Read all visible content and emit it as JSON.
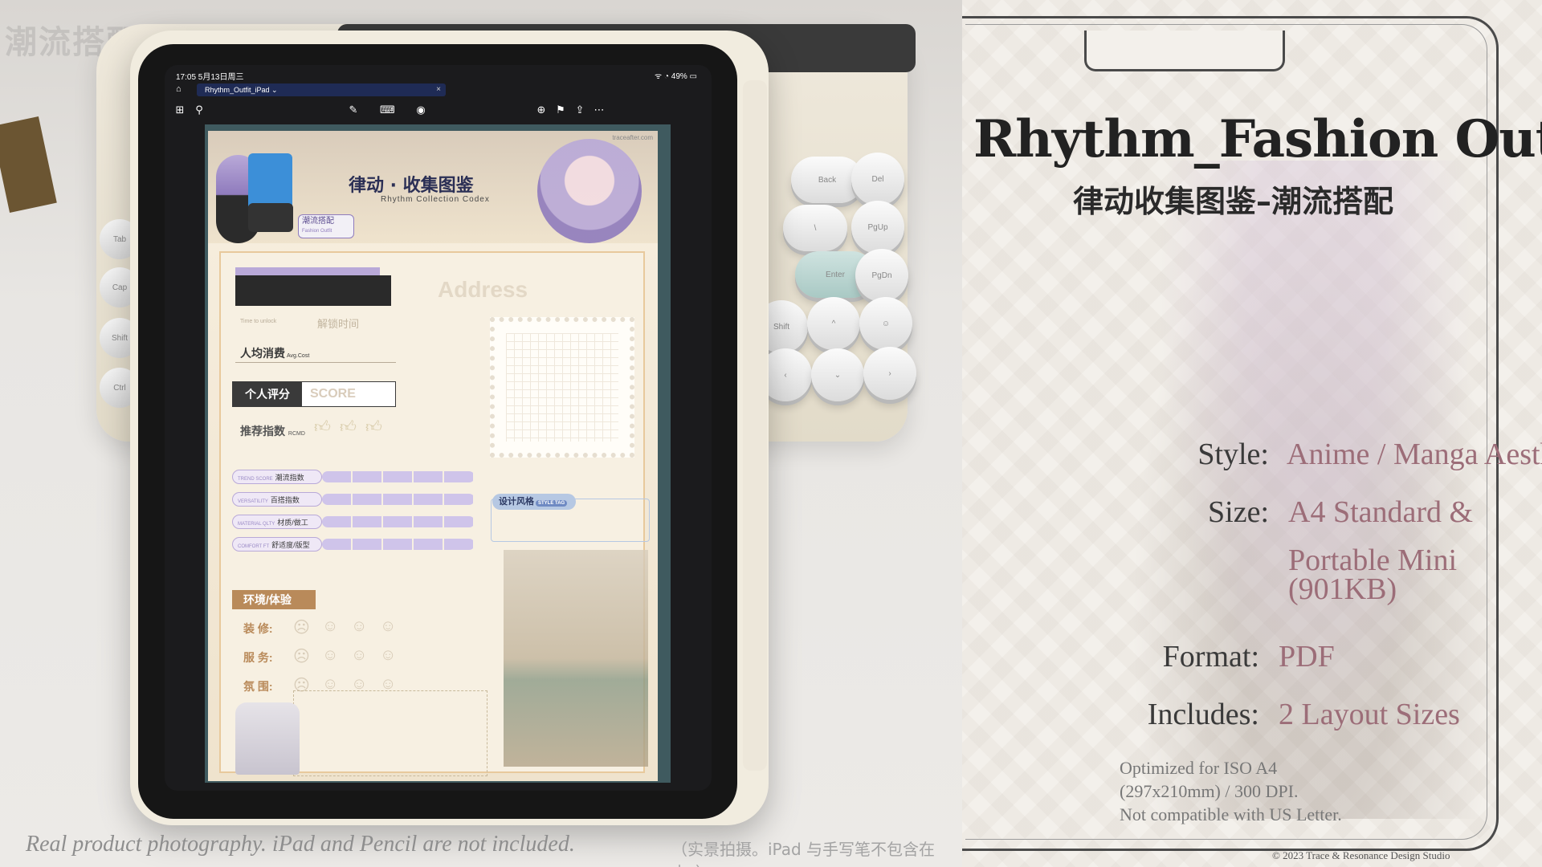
{
  "photo": {
    "watermark": "潮流搭配",
    "status_bar": {
      "time": "17:05  5月13日周三",
      "right": "ᯤ ◔ 49% ▭"
    },
    "tab": {
      "title": "Rhythm_Outfit_iPad  ⌄",
      "close": "×"
    },
    "toolbar_icons": [
      "grid-icon",
      "search-icon",
      "pencil-icon",
      "keyboard-icon",
      "microphone-icon",
      "add-page-icon",
      "bookmark-icon",
      "share-icon",
      "more-icon"
    ],
    "document": {
      "url": "traceafter.com",
      "title_cn": "律动 · 收集图鉴",
      "title_en": "Rhythm Collection Codex",
      "tag_cn": "潮流搭配",
      "tag_en": "Fashion Outfit",
      "address_placeholder": "Address",
      "unlock_en": "Time to unlock",
      "unlock_cn": "解锁时间",
      "avg_cn": "人均消费",
      "avg_en": "Avg.Cost",
      "score_label": "个人评分",
      "score_placeholder": "SCORE",
      "rcmd_cn": "推荐指数",
      "rcmd_en": "RCMD",
      "metrics": [
        {
          "en": "TREND SCORE",
          "cn": "潮流指数"
        },
        {
          "en": "VERSATILITY",
          "cn": "百搭指数"
        },
        {
          "en": "MATERIAL QLTY",
          "cn": "材质/做工"
        },
        {
          "en": "COMFORT FT",
          "cn": "舒适度/版型"
        }
      ],
      "env_tag": "环境/体验",
      "env_rows": [
        "装 修:",
        "服 务:",
        "氛 围:"
      ],
      "style_tag_cn": "设计风格",
      "style_tag_en": "STYLE TAG"
    },
    "keys": {
      "back": "Back",
      "del": "Del",
      "pgup": "PgUp",
      "enter": "Enter",
      "pgdn": "PgDn",
      "shift": "Shift",
      "up": "^",
      "down": "⌄",
      "left": "‹",
      "right": "›",
      "smile": "☺",
      "backslash": "\\"
    },
    "side_keys": [
      "Tab",
      "Cap",
      "Shift",
      "Ctrl"
    ],
    "caption": "Real product photography. iPad and Pencil are not included.",
    "caption_cn": "（实景拍摄。iPad 与手写笔不包含在内。）"
  },
  "panel": {
    "title": "Rhythm_Fashion Outfit",
    "subtitle": "律动收集图鉴–潮流搭配",
    "specs": [
      {
        "key": "Style:",
        "value": "Anime / Manga Aesthetic"
      },
      {
        "key": "Size:",
        "value": "A4 Standard &"
      },
      {
        "key": "",
        "value": "Portable Mini"
      },
      {
        "key": "",
        "value": "(901KB)"
      },
      {
        "key": "Format:",
        "value": "PDF"
      },
      {
        "key": "Includes:",
        "value": "2 Layout Sizes"
      }
    ],
    "note_lines": [
      "Optimized for ISO A4",
      "(297x210mm) / 300 DPI.",
      "Not compatible with US Letter."
    ],
    "copyright": "© 2023 Trace & Resonance Design Studio"
  },
  "colors": {
    "accent_mauve": "#9c6d78",
    "lavender": "#b9a9d8",
    "ink": "#222222"
  }
}
